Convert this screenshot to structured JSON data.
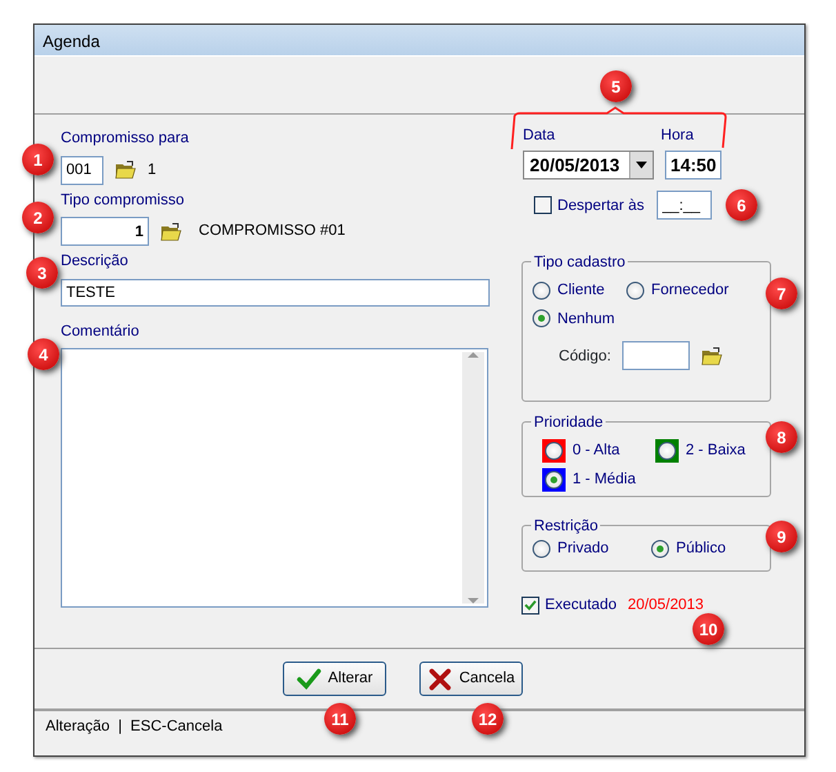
{
  "window": {
    "title": "Agenda"
  },
  "compromisso_para": {
    "label": "Compromisso para",
    "value": "001",
    "name": "1"
  },
  "tipo_compromisso": {
    "label": "Tipo compromisso",
    "value": "1",
    "name": "COMPROMISSO #01"
  },
  "descricao": {
    "label": "Descrição",
    "value": "TESTE"
  },
  "comentario": {
    "label": "Comentário"
  },
  "data": {
    "label": "Data",
    "value": "20/05/2013"
  },
  "hora": {
    "label": "Hora",
    "value": "14:50"
  },
  "despertar": {
    "label": "Despertar às",
    "checked": false,
    "value": "__:__"
  },
  "tipo_cadastro": {
    "title": "Tipo cadastro",
    "options": [
      {
        "label": "Cliente",
        "selected": false
      },
      {
        "label": "Fornecedor",
        "selected": false
      },
      {
        "label": "Nenhum",
        "selected": true
      }
    ],
    "codigo": {
      "label": "Código:"
    }
  },
  "prioridade": {
    "title": "Prioridade",
    "options": [
      {
        "label": "0 - Alta",
        "color": "#ff0000",
        "selected": false
      },
      {
        "label": "2 - Baixa",
        "color": "#008000",
        "selected": false
      },
      {
        "label": "1 - Média",
        "color": "#0000ff",
        "selected": true
      }
    ]
  },
  "restricao": {
    "title": "Restrição",
    "options": [
      {
        "label": "Privado",
        "selected": false
      },
      {
        "label": "Público",
        "selected": true
      }
    ]
  },
  "executado": {
    "label": "Executado",
    "checked": true,
    "date": "20/05/2013"
  },
  "buttons": [
    {
      "label": "Alterar",
      "kind": "confirm"
    },
    {
      "label": "Cancela",
      "kind": "cancel"
    }
  ],
  "status_bar": {
    "text": "Alteração  |  ESC-Cancela"
  },
  "callouts": [
    {
      "label": "1"
    },
    {
      "label": "2"
    },
    {
      "label": "3"
    },
    {
      "label": "4"
    },
    {
      "label": "5"
    },
    {
      "label": "6"
    },
    {
      "label": "7"
    },
    {
      "label": "8"
    },
    {
      "label": "9"
    },
    {
      "label": "10"
    },
    {
      "label": "11"
    },
    {
      "label": "12"
    }
  ]
}
